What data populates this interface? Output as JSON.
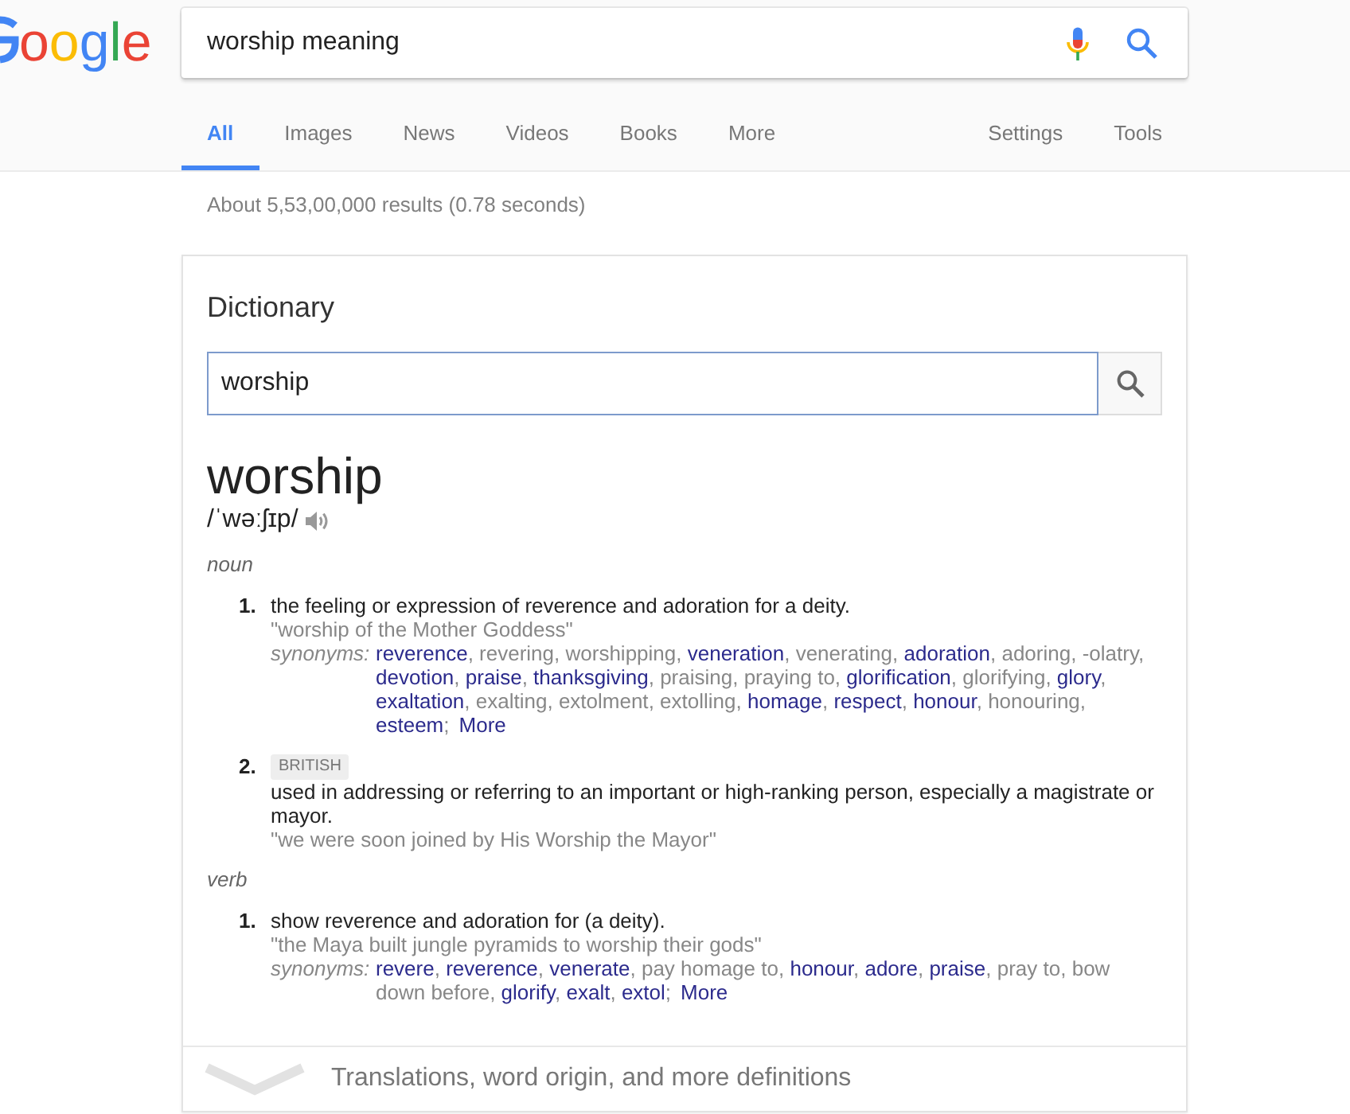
{
  "logo": {
    "text": "oogle"
  },
  "search": {
    "value": "worship meaning"
  },
  "tabs": [
    {
      "label": "All",
      "selected": true
    },
    {
      "label": "Images",
      "selected": false
    },
    {
      "label": "News",
      "selected": false
    },
    {
      "label": "Videos",
      "selected": false
    },
    {
      "label": "Books",
      "selected": false
    },
    {
      "label": "More",
      "selected": false
    }
  ],
  "menus": [
    "Settings",
    "Tools"
  ],
  "result_stats": "About 5,53,00,000 results (0.78 seconds)",
  "dictionary": {
    "title": "Dictionary",
    "search": {
      "value": "worship"
    },
    "headword": "worship",
    "pronunciation": "/ˈwəːʃɪp/",
    "senses": [
      {
        "part_of_speech": "noun",
        "definitions": [
          {
            "number": "1.",
            "text": "the feeling or expression of reverence and adoration for a deity.",
            "example": "\"worship of the Mother Goddess\"",
            "synonyms": {
              "label": "synonyms:",
              "separator": ", ",
              "end": ";",
              "words": [
                {
                  "text": "reverence",
                  "kind": "link"
                },
                {
                  "text": "revering",
                  "kind": "plain"
                },
                {
                  "text": "worshipping",
                  "kind": "plain"
                },
                {
                  "text": "veneration",
                  "kind": "link"
                },
                {
                  "text": "venerating",
                  "kind": "plain"
                },
                {
                  "text": "adoration",
                  "kind": "link"
                },
                {
                  "text": "adoring",
                  "kind": "plain"
                },
                {
                  "text": "-olatry",
                  "kind": "plain"
                },
                {
                  "text": "devotion",
                  "kind": "link"
                },
                {
                  "text": "praise",
                  "kind": "link"
                },
                {
                  "text": "thanksgiving",
                  "kind": "link"
                },
                {
                  "text": "praising",
                  "kind": "plain"
                },
                {
                  "text": "praying to",
                  "kind": "plain"
                },
                {
                  "text": "glorification",
                  "kind": "link"
                },
                {
                  "text": "glorifying",
                  "kind": "plain"
                },
                {
                  "text": "glory",
                  "kind": "link"
                },
                {
                  "text": "exaltation",
                  "kind": "link"
                },
                {
                  "text": "exalting",
                  "kind": "plain"
                },
                {
                  "text": "extolment",
                  "kind": "plain"
                },
                {
                  "text": "extolling",
                  "kind": "plain"
                },
                {
                  "text": "homage",
                  "kind": "link"
                },
                {
                  "text": "respect",
                  "kind": "link"
                },
                {
                  "text": "honour",
                  "kind": "link"
                },
                {
                  "text": "honouring",
                  "kind": "plain"
                },
                {
                  "text": "esteem",
                  "kind": "link"
                }
              ],
              "more": "More"
            }
          },
          {
            "number": "2.",
            "tag": "BRITISH",
            "text": "used in addressing or referring to an important or high-ranking person, especially a magistrate or mayor.",
            "example": "\"we were soon joined by His Worship the Mayor\""
          }
        ]
      },
      {
        "part_of_speech": "verb",
        "definitions": [
          {
            "number": "1.",
            "text": "show reverence and adoration for (a deity).",
            "example": "\"the Maya built jungle pyramids to worship their gods\"",
            "synonyms": {
              "label": "synonyms:",
              "separator": ", ",
              "end": ";",
              "words": [
                {
                  "text": "revere",
                  "kind": "link"
                },
                {
                  "text": "reverence",
                  "kind": "link"
                },
                {
                  "text": "venerate",
                  "kind": "link"
                },
                {
                  "text": "pay homage to",
                  "kind": "plain"
                },
                {
                  "text": "honour",
                  "kind": "link"
                },
                {
                  "text": "adore",
                  "kind": "link"
                },
                {
                  "text": "praise",
                  "kind": "link"
                },
                {
                  "text": "pray to",
                  "kind": "plain"
                },
                {
                  "text": "bow down before",
                  "kind": "plain"
                },
                {
                  "text": "glorify",
                  "kind": "link"
                },
                {
                  "text": "exalt",
                  "kind": "link"
                },
                {
                  "text": "extol",
                  "kind": "link"
                }
              ],
              "more": "More"
            }
          }
        ]
      }
    ],
    "footer": "Translations, word origin, and more definitions"
  }
}
